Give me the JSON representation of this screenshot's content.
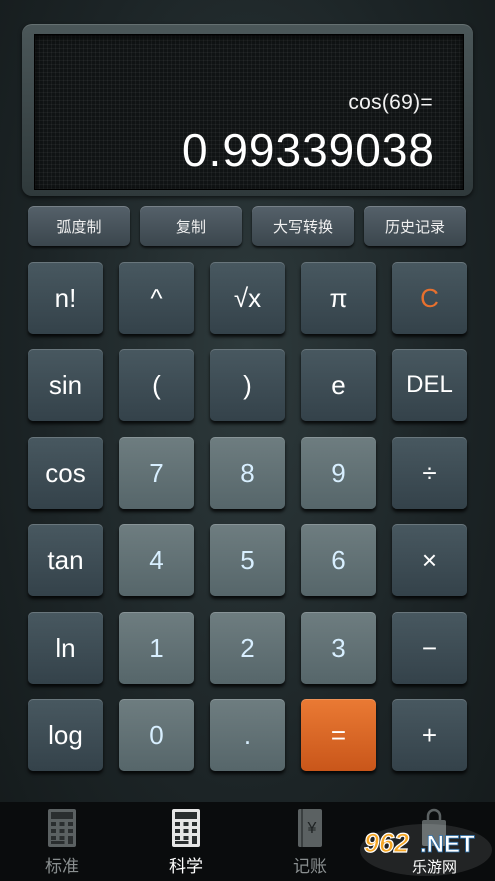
{
  "display": {
    "expression": "cos(69)=",
    "result": "0.99339038"
  },
  "function_row": [
    {
      "label": "弧度制",
      "name": "radian-mode-button"
    },
    {
      "label": "复制",
      "name": "copy-button"
    },
    {
      "label": "大写转换",
      "name": "uppercase-convert-button"
    },
    {
      "label": "历史记录",
      "name": "history-button"
    }
  ],
  "keys": [
    [
      {
        "label": "n!",
        "style": "dark",
        "name": "factorial-key"
      },
      {
        "label": "^",
        "style": "dark",
        "name": "power-key"
      },
      {
        "label": "√x",
        "style": "dark",
        "name": "sqrt-key"
      },
      {
        "label": "π",
        "style": "dark",
        "name": "pi-key"
      },
      {
        "label": "C",
        "style": "dark",
        "name": "clear-key"
      }
    ],
    [
      {
        "label": "sin",
        "style": "dark",
        "name": "sin-key"
      },
      {
        "label": "(",
        "style": "dark",
        "name": "open-paren-key"
      },
      {
        "label": ")",
        "style": "dark",
        "name": "close-paren-key"
      },
      {
        "label": "e",
        "style": "dark",
        "name": "e-key"
      },
      {
        "label": "DEL",
        "style": "dark",
        "name": "delete-key"
      }
    ],
    [
      {
        "label": "cos",
        "style": "dark",
        "name": "cos-key"
      },
      {
        "label": "7",
        "style": "num",
        "name": "digit-7-key"
      },
      {
        "label": "8",
        "style": "num",
        "name": "digit-8-key"
      },
      {
        "label": "9",
        "style": "num",
        "name": "digit-9-key"
      },
      {
        "label": "÷",
        "style": "dark",
        "name": "divide-key"
      }
    ],
    [
      {
        "label": "tan",
        "style": "dark",
        "name": "tan-key"
      },
      {
        "label": "4",
        "style": "num",
        "name": "digit-4-key"
      },
      {
        "label": "5",
        "style": "num",
        "name": "digit-5-key"
      },
      {
        "label": "6",
        "style": "num",
        "name": "digit-6-key"
      },
      {
        "label": "×",
        "style": "dark",
        "name": "multiply-key"
      }
    ],
    [
      {
        "label": "ln",
        "style": "dark",
        "name": "ln-key"
      },
      {
        "label": "1",
        "style": "num",
        "name": "digit-1-key"
      },
      {
        "label": "2",
        "style": "num",
        "name": "digit-2-key"
      },
      {
        "label": "3",
        "style": "num",
        "name": "digit-3-key"
      },
      {
        "label": "−",
        "style": "dark",
        "name": "minus-key"
      }
    ],
    [
      {
        "label": "log",
        "style": "dark",
        "name": "log-key"
      },
      {
        "label": "0",
        "style": "num",
        "name": "digit-0-key"
      },
      {
        "label": ".",
        "style": "num",
        "name": "decimal-key"
      },
      {
        "label": "=",
        "style": "orange",
        "name": "equals-key"
      },
      {
        "label": "+",
        "style": "dark",
        "name": "plus-key"
      }
    ]
  ],
  "nav": {
    "items": [
      {
        "label": "标准",
        "icon": "calculator-icon",
        "active": false
      },
      {
        "label": "科学",
        "icon": "calculator-icon",
        "active": true
      },
      {
        "label": "记账",
        "icon": "ledger-yen-icon",
        "active": false
      },
      {
        "label": "",
        "icon": "shopping-bag-icon",
        "active": false
      }
    ]
  },
  "watermark": {
    "brand": "962.NET",
    "subtitle": "乐游网"
  },
  "colors": {
    "accent_orange": "#e8702e",
    "equals_key": "#d9621f",
    "display_text": "#ffffff"
  }
}
